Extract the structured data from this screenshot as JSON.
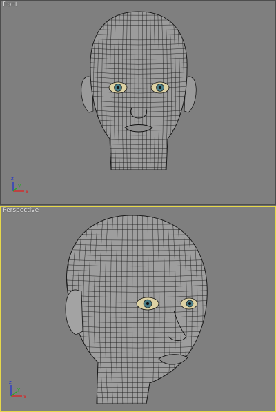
{
  "viewports": [
    {
      "label": "front",
      "active": false
    },
    {
      "label": "Perspective",
      "active": true
    }
  ],
  "axis": {
    "x": "x",
    "y": "y",
    "z": "z"
  },
  "colors": {
    "background": "#7f7f7f",
    "active_border": "#e6d84a",
    "mesh_fill": "#9c9c9c",
    "wire": "#1a1a1a",
    "axis_x": "#d22",
    "axis_y": "#2a2",
    "axis_z": "#23c"
  }
}
